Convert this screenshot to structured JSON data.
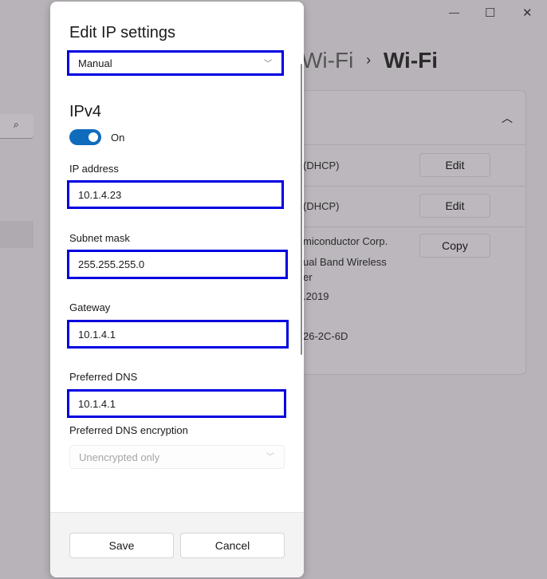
{
  "window": {
    "minimize": "—",
    "maximize": "☐",
    "close": "✕"
  },
  "background": {
    "breadcrumb_parent": "Wi-Fi",
    "breadcrumb_sep": "›",
    "breadcrumb_current": "Wi-Fi",
    "rows": [
      {
        "value": "(DHCP)",
        "button": "Edit"
      },
      {
        "value": "(DHCP)",
        "button": "Edit"
      }
    ],
    "details": [
      "miconductor Corp.",
      "ual Band Wireless",
      "er",
      ".2019",
      "26-2C-6D"
    ],
    "copy_button": "Copy"
  },
  "dialog": {
    "title": "Edit IP settings",
    "mode": "Manual",
    "section": "IPv4",
    "toggle_label": "On",
    "toggle_on": true,
    "fields": [
      {
        "label": "IP address",
        "value": "10.1.4.23"
      },
      {
        "label": "Subnet mask",
        "value": "255.255.255.0"
      },
      {
        "label": "Gateway",
        "value": "10.1.4.1"
      },
      {
        "label": "Preferred DNS",
        "value": "10.1.4.1"
      }
    ],
    "dns_encryption_label": "Preferred DNS encryption",
    "dns_encryption_value": "Unencrypted only",
    "save": "Save",
    "cancel": "Cancel"
  },
  "colors": {
    "accent": "#0f6cbd",
    "highlight": "#0000e0"
  }
}
